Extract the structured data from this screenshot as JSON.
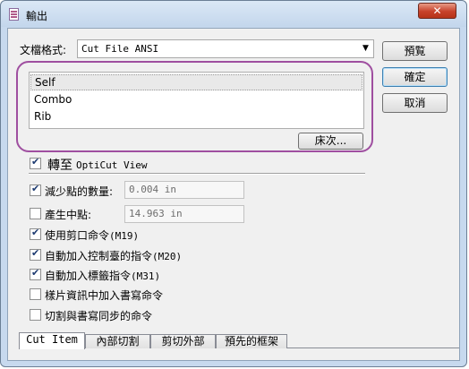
{
  "window": {
    "title": "輸出",
    "close_label": "✕"
  },
  "format": {
    "label": "文檔格式:",
    "value": "Cut File ANSI"
  },
  "buttons": {
    "preview": "預覧",
    "ok": "確定",
    "cancel": "取消"
  },
  "listbox": {
    "items": [
      "Self",
      "Combo",
      "Rib"
    ],
    "selected_index": 0
  },
  "sequence_button": "床次...",
  "options": {
    "goto_opticut": {
      "label": "轉至",
      "label_mono": "OptiCut View",
      "checked": true
    },
    "reduce_points": {
      "label": "減少點的數量:",
      "value": "0.004 in",
      "checked": true
    },
    "mid_points": {
      "label": "產生中點:",
      "value": "14.963 in",
      "checked": false
    },
    "use_cut": {
      "label": "使用剪口命令",
      "code": "(M19)",
      "checked": true
    },
    "add_control": {
      "label": "自動加入控制臺的指令",
      "code": "(M20)",
      "checked": true
    },
    "add_label": {
      "label": "自動加入標籤指令",
      "code": "(M31)",
      "checked": true
    },
    "add_write": {
      "label": "樣片資訊中加入書寫命令",
      "checked": false
    },
    "sync_write": {
      "label": "切割與書寫同步的命令",
      "checked": false
    }
  },
  "tabs": [
    "Cut Item",
    "內部切割",
    "剪切外部",
    "預先的框架"
  ],
  "active_tab": 0
}
